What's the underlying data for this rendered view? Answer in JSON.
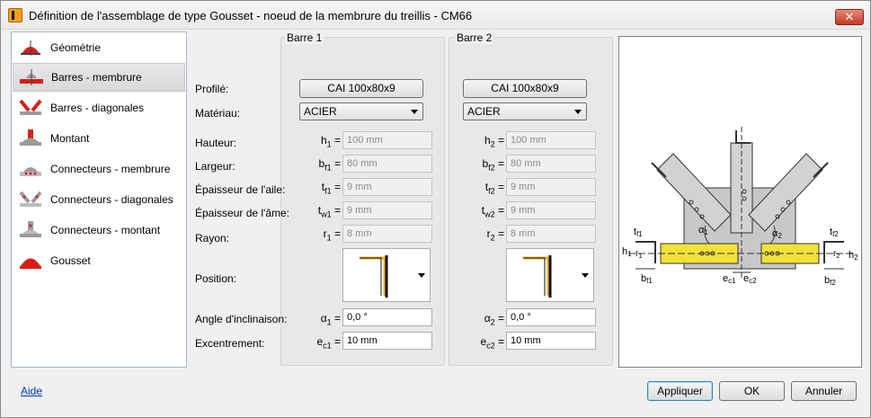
{
  "window": {
    "title": "Définition de l'assemblage de type Gousset - noeud de la membrure du treillis - CM66",
    "close_label": "✕"
  },
  "sidebar": {
    "items": [
      {
        "label": "Géométrie",
        "icon": "geometry-icon"
      },
      {
        "label": "Barres - membrure",
        "icon": "chord-bars-icon",
        "selected": true
      },
      {
        "label": "Barres - diagonales",
        "icon": "diagonal-bars-icon"
      },
      {
        "label": "Montant",
        "icon": "vertical-post-icon"
      },
      {
        "label": "Connecteurs - membrure",
        "icon": "chord-connectors-icon"
      },
      {
        "label": "Connecteurs - diagonales",
        "icon": "diagonal-connectors-icon"
      },
      {
        "label": "Connecteurs - montant",
        "icon": "post-connectors-icon"
      },
      {
        "label": "Gousset",
        "icon": "gusset-icon"
      }
    ]
  },
  "labels": {
    "profile": "Profilé:",
    "material": "Matériau:",
    "height": "Hauteur:",
    "width": "Largeur:",
    "flange_thickness": "Épaisseur de l'aile:",
    "web_thickness": "Épaisseur de l'âme:",
    "radius": "Rayon:",
    "position": "Position:",
    "angle": "Angle d'inclinaison:",
    "eccentricity": "Excentrement:"
  },
  "bar1": {
    "title": "Barre 1",
    "profile": "CAI 100x80x9",
    "material": "ACIER",
    "sym_h": "h",
    "sub_h": "1",
    "sym_b": "b",
    "sub_b": "f1",
    "sym_tf": "t",
    "sub_tf": "f1",
    "sym_tw": "t",
    "sub_tw": "w1",
    "sym_r": "r",
    "sub_r": "1",
    "sym_a": "α",
    "sub_a": "1",
    "sym_e": "e",
    "sub_e": "c1",
    "height": "100 mm",
    "width": "80 mm",
    "tf": "9 mm",
    "tw": "9 mm",
    "radius": "8 mm",
    "angle": "0,0 °",
    "ecc": "10 mm"
  },
  "bar2": {
    "title": "Barre 2",
    "profile": "CAI 100x80x9",
    "material": "ACIER",
    "sym_h": "h",
    "sub_h": "2",
    "sym_b": "b",
    "sub_b": "f2",
    "sym_tf": "t",
    "sub_tf": "f2",
    "sym_tw": "t",
    "sub_tw": "w2",
    "sym_r": "r",
    "sub_r": "2",
    "sym_a": "α",
    "sub_a": "2",
    "sym_e": "e",
    "sub_e": "c2",
    "height": "100 mm",
    "width": "80 mm",
    "tf": "9 mm",
    "tw": "9 mm",
    "radius": "8 mm",
    "angle": "0,0 °",
    "ecc": "10 mm"
  },
  "drawing": {
    "labels": {
      "tf1": "t",
      "tf1_sub": "f1",
      "tf2": "t",
      "tf2_sub": "f2",
      "h1": "h",
      "h1_sub": "1",
      "h2": "h",
      "h2_sub": "2",
      "r1": "r",
      "r1_sub": "1",
      "r2": "r",
      "r2_sub": "2",
      "bf1": "b",
      "bf1_sub": "f1",
      "bf2": "b",
      "bf2_sub": "f2",
      "a1": "α",
      "a1_sub": "1",
      "a2": "α",
      "a2_sub": "2",
      "ec1": "e",
      "ec1_sub": "c1",
      "ec2": "e",
      "ec2_sub": "c2"
    },
    "colors": {
      "chord": "#f2e13a",
      "gusset": "#c8c8c8",
      "diagonal": "#d2d2d2"
    }
  },
  "footer": {
    "help": "Aide",
    "apply": "Appliquer",
    "ok": "OK",
    "cancel": "Annuler"
  }
}
